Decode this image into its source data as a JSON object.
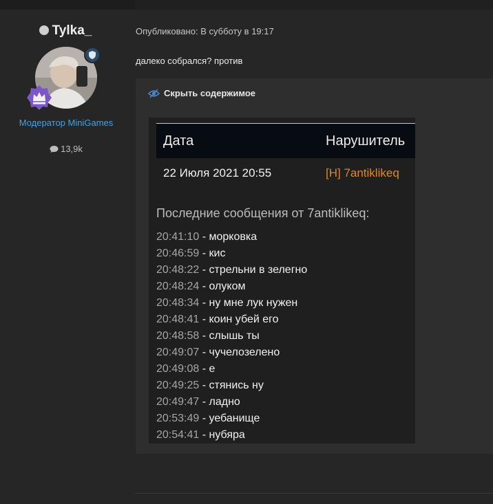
{
  "user": {
    "name": "Tylka_",
    "role": "Модератор MiniGames",
    "message_count": "13,9k"
  },
  "post": {
    "published": "Опубликовано: В субботу в 19:17",
    "text": "далеко собрался? против",
    "spoiler_label": "Скрыть содержимое"
  },
  "screenshot": {
    "col_date": "Дата",
    "col_violator": "Нарушитель",
    "row_date": "22 Июля 2021 20:55",
    "row_violator": "[H] 7antiklikeq",
    "log_title": "Последние сообщения от 7antiklikeq:",
    "log": [
      {
        "time": "20:41:10",
        "msg": " - морковка"
      },
      {
        "time": "20:46:59",
        "msg": " - кис"
      },
      {
        "time": "20:48:22",
        "msg": " - стрельни в зелегно"
      },
      {
        "time": "20:48:24",
        "msg": " - олуком"
      },
      {
        "time": "20:48:34",
        "msg": " - ну мне лук нужен"
      },
      {
        "time": "20:48:41",
        "msg": " - коин убей его"
      },
      {
        "time": "20:48:58",
        "msg": " - слышь ты"
      },
      {
        "time": "20:49:07",
        "msg": " - чучелозелено"
      },
      {
        "time": "20:49:08",
        "msg": " - е"
      },
      {
        "time": "20:49:25",
        "msg": " - стянись ну"
      },
      {
        "time": "20:49:47",
        "msg": " - ладно"
      },
      {
        "time": "20:53:49",
        "msg": " - уебанище"
      },
      {
        "time": "20:54:41",
        "msg": " - нубяра"
      }
    ]
  },
  "colors": {
    "role": "#3fa4e8",
    "violator": "#d98a29",
    "background": "#262626"
  }
}
